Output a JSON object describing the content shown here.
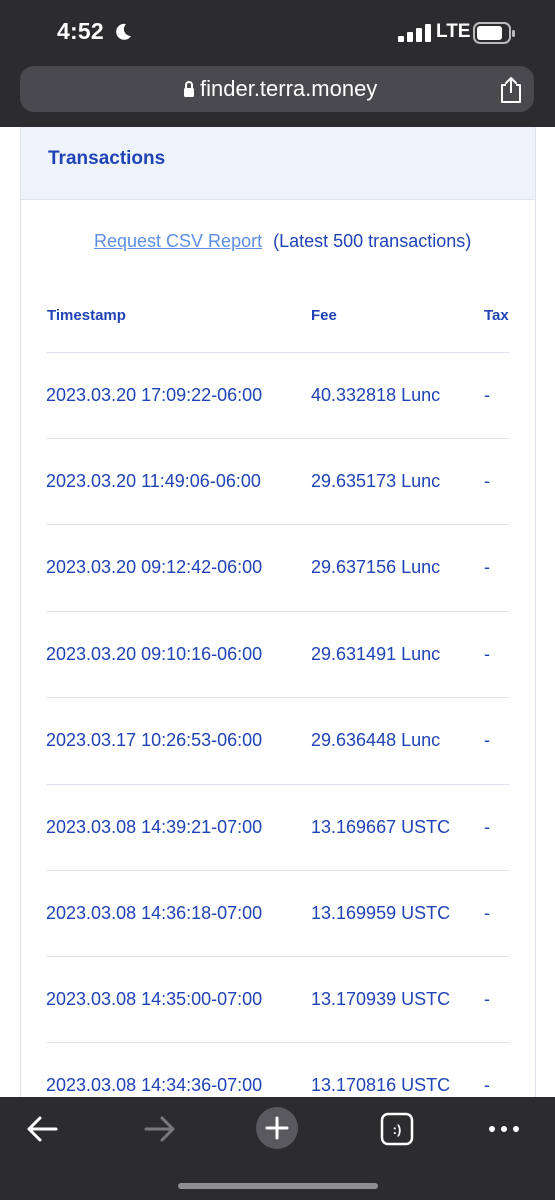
{
  "status_bar": {
    "time": "4:52",
    "network": "LTE",
    "icons": [
      "moon-icon",
      "signal-icon",
      "battery-icon"
    ]
  },
  "browser": {
    "url": "finder.terra.money",
    "icons": [
      "lock-icon",
      "share-icon"
    ]
  },
  "card": {
    "title": "Transactions",
    "csv_link": "Request CSV Report",
    "csv_note": "(Latest 500 transactions)"
  },
  "table": {
    "headers": {
      "timestamp": "Timestamp",
      "fee": "Fee",
      "tax": "Tax"
    },
    "rows": [
      {
        "timestamp": "2023.03.20 17:09:22-06:00",
        "fee": "40.332818 Lunc",
        "tax": "-"
      },
      {
        "timestamp": "2023.03.20 11:49:06-06:00",
        "fee": "29.635173 Lunc",
        "tax": "-"
      },
      {
        "timestamp": "2023.03.20 09:12:42-06:00",
        "fee": "29.637156 Lunc",
        "tax": "-"
      },
      {
        "timestamp": "2023.03.20 09:10:16-06:00",
        "fee": "29.631491 Lunc",
        "tax": "-"
      },
      {
        "timestamp": "2023.03.17 10:26:53-06:00",
        "fee": "29.636448 Lunc",
        "tax": "-"
      },
      {
        "timestamp": "2023.03.08 14:39:21-07:00",
        "fee": "13.169667 USTC",
        "tax": "-"
      },
      {
        "timestamp": "2023.03.08 14:36:18-07:00",
        "fee": "13.169959 USTC",
        "tax": "-"
      },
      {
        "timestamp": "2023.03.08 14:35:00-07:00",
        "fee": "13.170939 USTC",
        "tax": "-"
      },
      {
        "timestamp": "2023.03.08 14:34:36-07:00",
        "fee": "13.170816 USTC",
        "tax": "-"
      }
    ]
  },
  "toolbar": {
    "icons": [
      "back-icon",
      "forward-icon",
      "new-tab-icon",
      "tabs-icon",
      "more-icon"
    ],
    "tabs_glyph": ":)"
  },
  "colors": {
    "chrome": "#2c2c2e",
    "accent": "#2043b5",
    "link": "#5d8ee6",
    "header_bg": "#eef3fc",
    "divider": "#dde3ef"
  }
}
